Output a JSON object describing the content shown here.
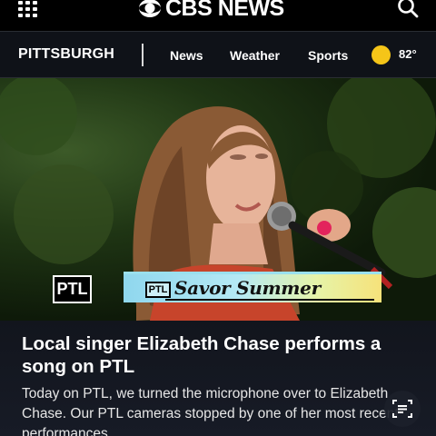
{
  "header": {
    "menu_icon": "grid-menu-icon",
    "brand_text": "CBS NEWS",
    "search_icon": "search-icon"
  },
  "local_nav": {
    "city": "PITTSBURGH",
    "links": [
      "News",
      "Weather",
      "Sports"
    ],
    "weather_icon": "sun-icon",
    "temperature": "82°"
  },
  "video": {
    "bug_text": "PTL",
    "lower_third_badge": "PTL",
    "lower_third_title": "Savor Summer"
  },
  "article": {
    "headline": "Local singer Elizabeth Chase performs a song on PTL",
    "summary": "Today on PTL, we turned the microphone over to Elizabeth Chase. Our PTL cameras stopped by one of her most recent performances."
  },
  "floating_action": {
    "icon": "transcript-icon"
  },
  "colors": {
    "header_bg": "#000000",
    "nav_bg": "#0f1218",
    "sun": "#f5c518",
    "article_bg": "#12151d"
  }
}
